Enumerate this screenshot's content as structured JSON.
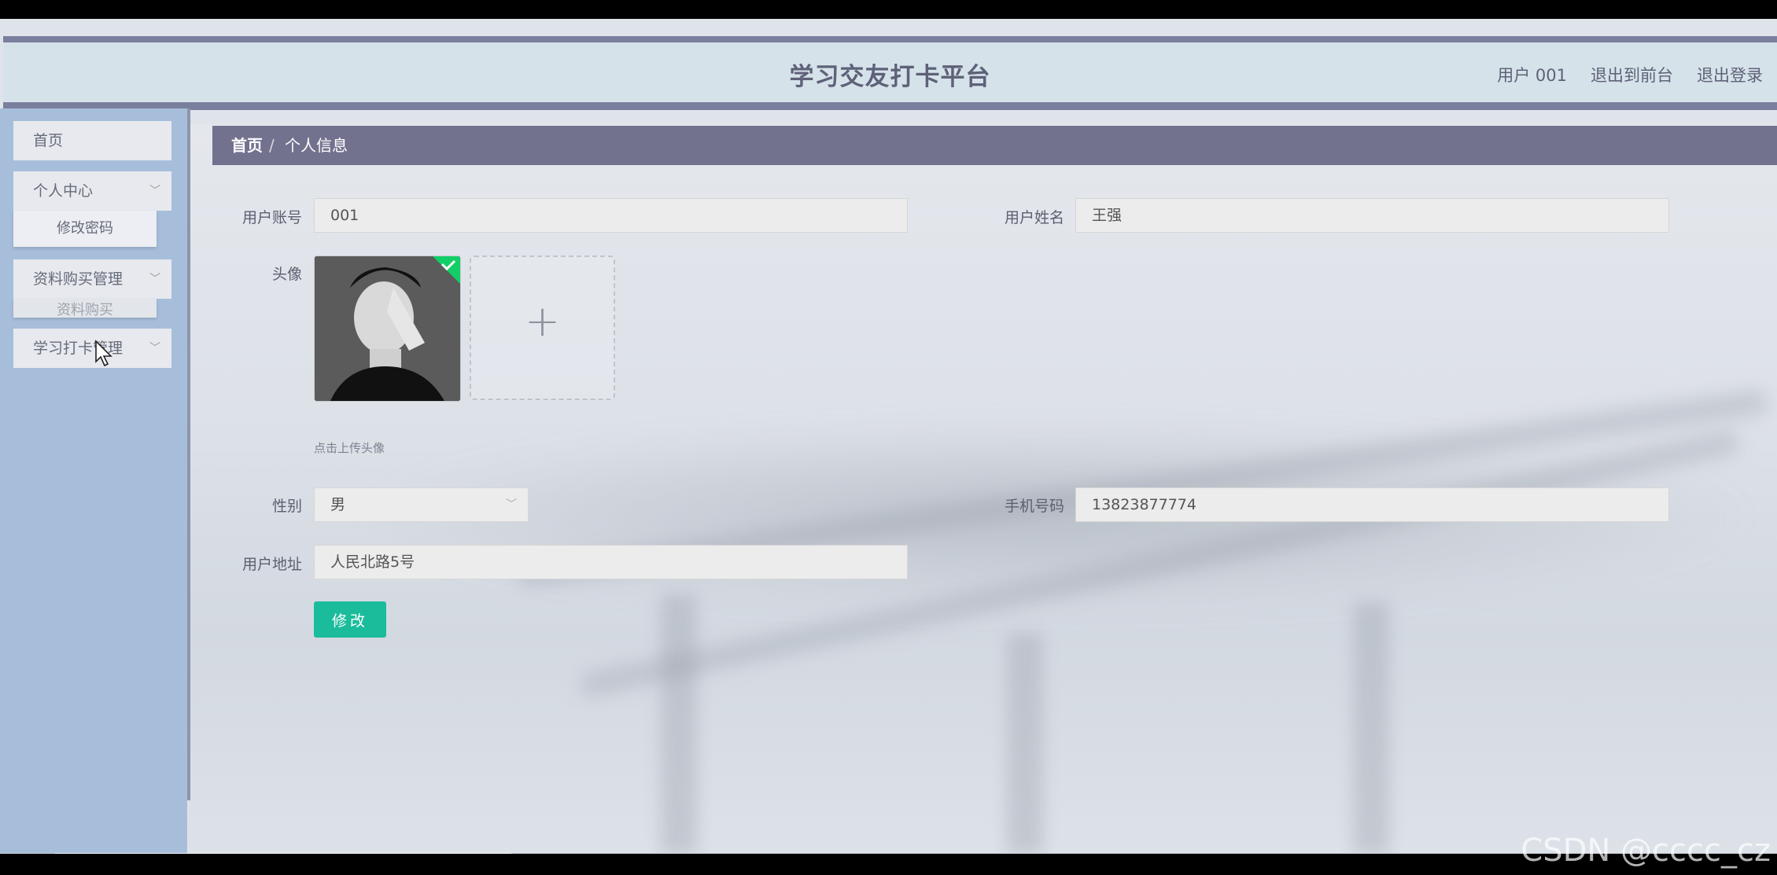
{
  "header": {
    "title": "学习交友打卡平台",
    "user": "用户 001",
    "to_front": "退出到前台",
    "logout": "退出登录"
  },
  "sidebar": {
    "home": "首页",
    "personal_center": "个人中心",
    "change_password": "修改密码",
    "material_purchase_mgmt": "资料购买管理",
    "material_purchase": "资料购买",
    "study_checkin_mgmt": "学习打卡管理"
  },
  "breadcrumb": {
    "home": "首页",
    "separator": "/",
    "current": "个人信息"
  },
  "form": {
    "account_label": "用户账号",
    "account_value": "001",
    "name_label": "用户姓名",
    "name_value": "王强",
    "avatar_label": "头像",
    "avatar_hint": "点击上传头像",
    "upload_plus": "+",
    "gender_label": "性别",
    "gender_value": "男",
    "phone_label": "手机号码",
    "phone_value": "13823877774",
    "address_label": "用户地址",
    "address_value": "人民北路5号",
    "submit_label": "修改"
  },
  "watermark": "CSDN @cccc_cz",
  "colors": {
    "header_bg": "#d6e2ea",
    "header_border": "#7b7f9e",
    "sidebar_bg": "#a7bedb",
    "breadcrumb_bg": "#72728f",
    "submit_bg": "#1abc9c"
  }
}
